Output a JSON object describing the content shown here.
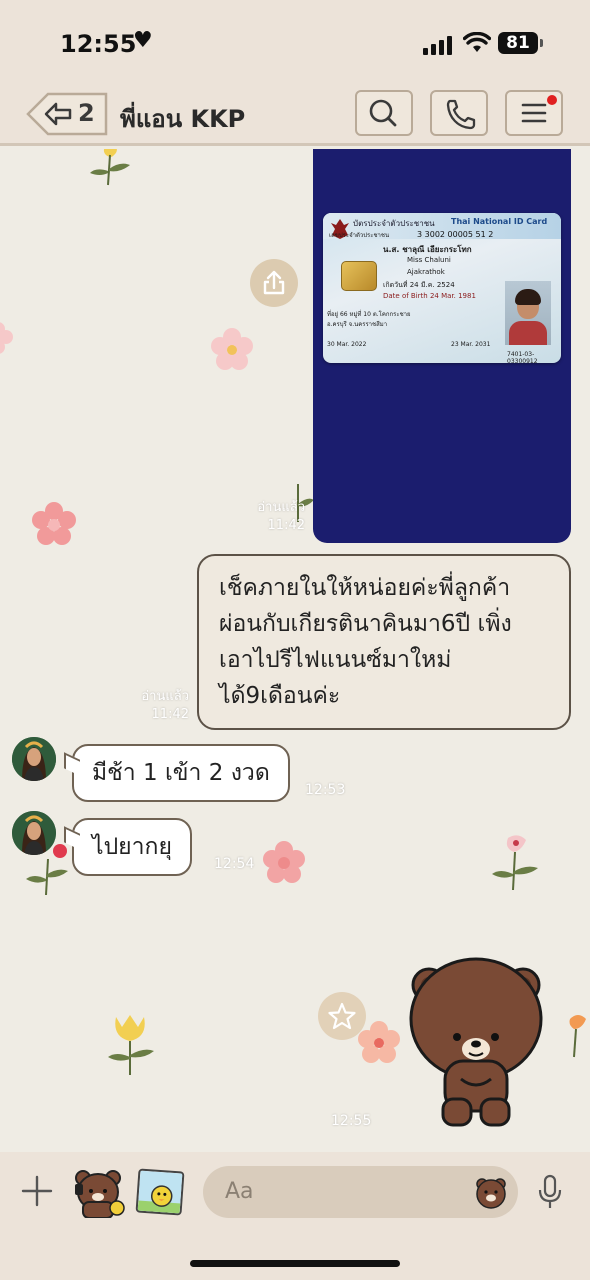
{
  "status_bar": {
    "time": "12:55",
    "battery": "81"
  },
  "header": {
    "back_count": "2",
    "title": "พี่แอน KKP"
  },
  "id_card": {
    "title_th": "บัตรประจำตัวประชาชน",
    "title_en": "Thai National ID Card",
    "id_label": "เลขประจำตัวประชาชน",
    "id_number": "3 3002 00005 51 2",
    "name_th": "น.ส. ชาลุณี เอียะกระโทก",
    "name_en_first": "Miss Chaluni",
    "name_en_last": "Ajakrathok",
    "dob_th": "เกิดวันที่ 24 มี.ค. 2524",
    "dob_en": "Date of Birth 24 Mar. 1981",
    "address": "ที่อยู่ 66 หมู่ที่ 10 ต.โคกกระชาย",
    "address2": "อ.ครบุรี จ.นครราชสีมา",
    "issue": "30 Mar. 2022",
    "expiry": "23 Mar. 2031",
    "serial": "7401-03-03300912"
  },
  "messages": [
    {
      "id": "photo",
      "read": "อ่านแล้ว",
      "time": "11:42"
    },
    {
      "id": "text-out",
      "lines": [
        "เช็คภายในให้หน่อยค่ะพี่ลูกค้า",
        "ผ่อนกับเกียรตินาคินมา6ปี เพิ่ง",
        "เอาไปรีไฟแนนซ์มาใหม่",
        "ได้9เดือนค่ะ"
      ],
      "read": "อ่านแล้ว",
      "time": "11:42"
    },
    {
      "id": "in-1",
      "text": "มีช้า 1 เข้า 2 งวด",
      "time": "12:53"
    },
    {
      "id": "in-2",
      "text": "ไปยากยุ",
      "time": "12:54"
    },
    {
      "id": "sticker",
      "time": "12:55"
    }
  ],
  "input": {
    "placeholder": "Aa"
  },
  "colors": {
    "header_bg": "#ece3d9",
    "bubble_border": "#5c5247",
    "unread_dot": "#e02020"
  },
  "icons": [
    "back-arrow-icon",
    "search-icon",
    "phone-icon",
    "menu-icon",
    "share-icon",
    "star-icon",
    "plus-icon",
    "mic-icon"
  ]
}
